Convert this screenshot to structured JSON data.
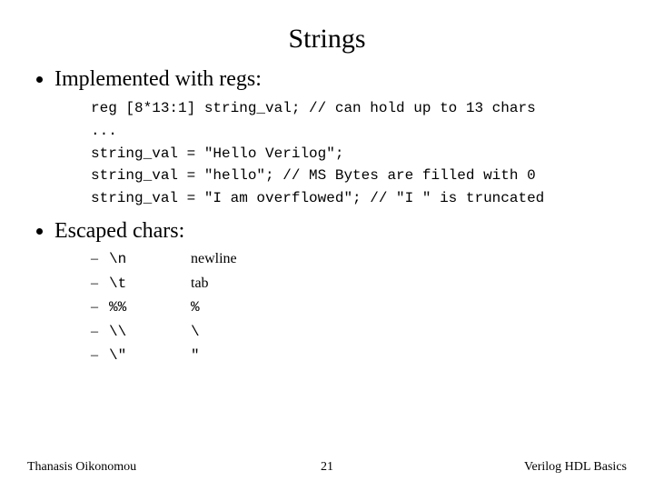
{
  "title": "Strings",
  "bullets": {
    "first": "Implemented with regs:",
    "second": "Escaped chars:"
  },
  "code": {
    "l1": "reg [8*13:1] string_val; // can hold up to 13 chars",
    "l2": "...",
    "l3": "string_val = \"Hello Verilog\";",
    "l4": "string_val = \"hello\"; // MS Bytes are filled with 0",
    "l5": "string_val = \"I am overflowed\"; // \"I \" is truncated"
  },
  "escaped": [
    {
      "code": "\\n",
      "desc": "newline",
      "mono": false
    },
    {
      "code": "\\t",
      "desc": "tab",
      "mono": false
    },
    {
      "code": "%%",
      "desc": "%",
      "mono": true
    },
    {
      "code": "\\\\",
      "desc": "\\",
      "mono": true
    },
    {
      "code": "\\\"",
      "desc": "\"",
      "mono": true
    }
  ],
  "footer": {
    "left": "Thanasis Oikonomou",
    "center": "21",
    "right": "Verilog HDL Basics"
  },
  "dash": "–"
}
